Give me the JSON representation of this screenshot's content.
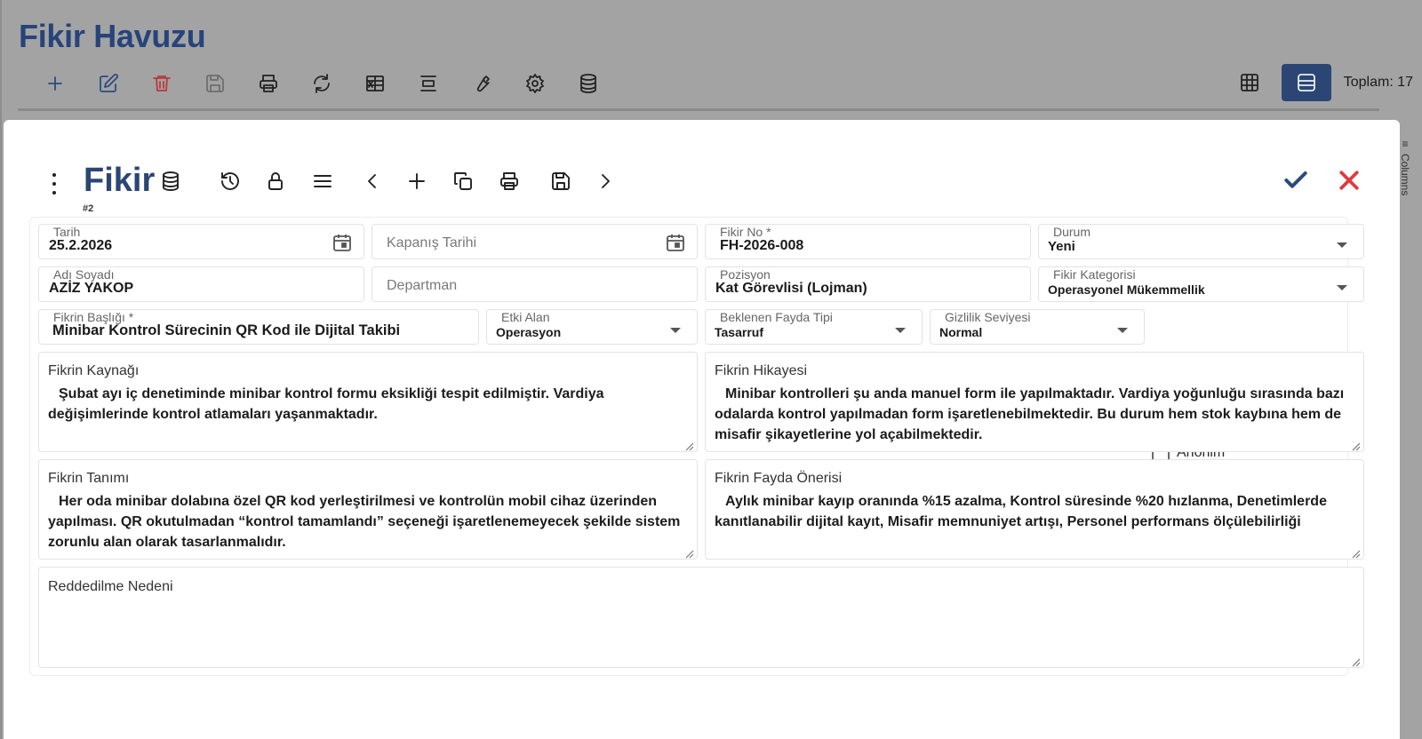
{
  "app": {
    "title": "Fikir Havuzu",
    "total_label": "Toplam: 17",
    "columns_label": "Columns",
    "toolbar_icons": [
      "plus-icon",
      "edit-icon",
      "trash-icon",
      "save-icon",
      "print-icon",
      "refresh-icon",
      "excel-icon",
      "align-center-icon",
      "wrench-icon",
      "gear-icon",
      "database-icon"
    ]
  },
  "modal": {
    "title": "Fikir",
    "record_no": "#2",
    "toolbar_icons": [
      "database-icon",
      "history-icon",
      "lock-icon",
      "menu-icon",
      "chevron-left-icon",
      "plus-icon",
      "copy-icon",
      "print-icon",
      "save-icon",
      "chevron-right-icon"
    ]
  },
  "form": {
    "tarih": {
      "label": "Tarih",
      "value": "25.2.2026"
    },
    "kapanis_tarihi": {
      "placeholder": "Kapanış Tarihi"
    },
    "fikir_no": {
      "label": "Fikir No *",
      "value": "FH-2026-008"
    },
    "durum": {
      "label": "Durum",
      "value": "Yeni"
    },
    "adi_soyadi": {
      "label": "Adı Soyadı",
      "value": "AZİZ YAKOP"
    },
    "departman": {
      "placeholder": "Departman"
    },
    "pozisyon": {
      "label": "Pozisyon",
      "value": "Kat Görevlisi (Lojman)"
    },
    "fikir_kategorisi": {
      "label": "Fikir Kategorisi",
      "value": "Operasyonel Mükemmellik"
    },
    "fikrin_basligi": {
      "label": "Fikrin Başlığı *",
      "value": "Minibar Kontrol Sürecinin QR Kod ile Dijital Takibi"
    },
    "etki_alan": {
      "label": "Etki Alan",
      "value": "Operasyon"
    },
    "beklenen_fayda_tipi": {
      "label": "Beklenen Fayda Tipi",
      "value": "Tasarruf"
    },
    "gizlilik_seviyesi": {
      "label": "Gizlilik Seviyesi",
      "value": "Normal"
    },
    "anonim": {
      "label": "Anonim",
      "checked": false
    },
    "fikrin_kaynagi": {
      "label": "Fikrin Kaynağı",
      "value": "Şubat ayı iç denetiminde minibar kontrol formu eksikliği tespit edilmiştir. Vardiya değişimlerinde kontrol atlamaları yaşanmaktadır."
    },
    "fikrin_hikayesi": {
      "label": "Fikrin Hikayesi",
      "value": "Minibar kontrolleri şu anda manuel form ile yapılmaktadır. Vardiya yoğunluğu sırasında bazı odalarda kontrol yapılmadan form işaretlenebilmektedir. Bu durum hem stok kaybına hem de misafir şikayetlerine yol açabilmektedir."
    },
    "fikrin_tanimi": {
      "label": "Fikrin Tanımı",
      "value": "Her oda minibar dolabına özel QR kod yerleştirilmesi ve kontrolün mobil cihaz üzerinden yapılması. QR okutulmadan “kontrol tamamlandı” seçeneği işaretlenemeyecek şekilde sistem zorunlu alan olarak tasarlanmalıdır."
    },
    "fikrin_fayda_onerisi": {
      "label": "Fikrin Fayda Önerisi",
      "value": "Aylık minibar kayıp oranında %15 azalma, Kontrol süresinde %20 hızlanma, Denetimlerde kanıtlanabilir dijital kayıt, Misafir memnuniyet artışı, Personel performans ölçülebilirliği"
    },
    "reddedilme_nedeni": {
      "label": "Reddedilme Nedeni",
      "value": ""
    }
  },
  "colors": {
    "brand": "#2b4674",
    "danger": "#e03b3b",
    "active_view": "#2b4674"
  }
}
